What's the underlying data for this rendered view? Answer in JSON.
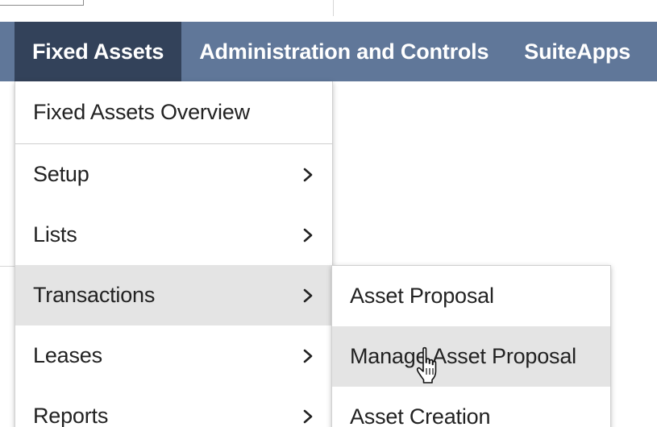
{
  "nav": {
    "tabs": [
      {
        "label": "Fixed Assets",
        "active": true
      },
      {
        "label": "Administration and Controls",
        "active": false
      },
      {
        "label": "SuiteApps",
        "active": false
      }
    ]
  },
  "fixed_assets_menu": {
    "items": [
      {
        "label": "Fixed Assets Overview",
        "has_submenu": false
      },
      {
        "label": "Setup",
        "has_submenu": true
      },
      {
        "label": "Lists",
        "has_submenu": true
      },
      {
        "label": "Transactions",
        "has_submenu": true,
        "highlighted": true
      },
      {
        "label": "Leases",
        "has_submenu": true
      },
      {
        "label": "Reports",
        "has_submenu": true
      }
    ]
  },
  "transactions_submenu": {
    "items": [
      {
        "label": "Asset Proposal"
      },
      {
        "label": "Manage Asset Proposal",
        "hovered": true
      },
      {
        "label": "Asset Creation"
      }
    ]
  },
  "colors": {
    "nav_background": "#607799",
    "nav_active_tab": "#33425a",
    "menu_highlight": "#e4e4e4",
    "text": "#222222"
  },
  "icons": {
    "chevron": "chevron-right-icon",
    "pointer": "hand-pointer-icon"
  }
}
